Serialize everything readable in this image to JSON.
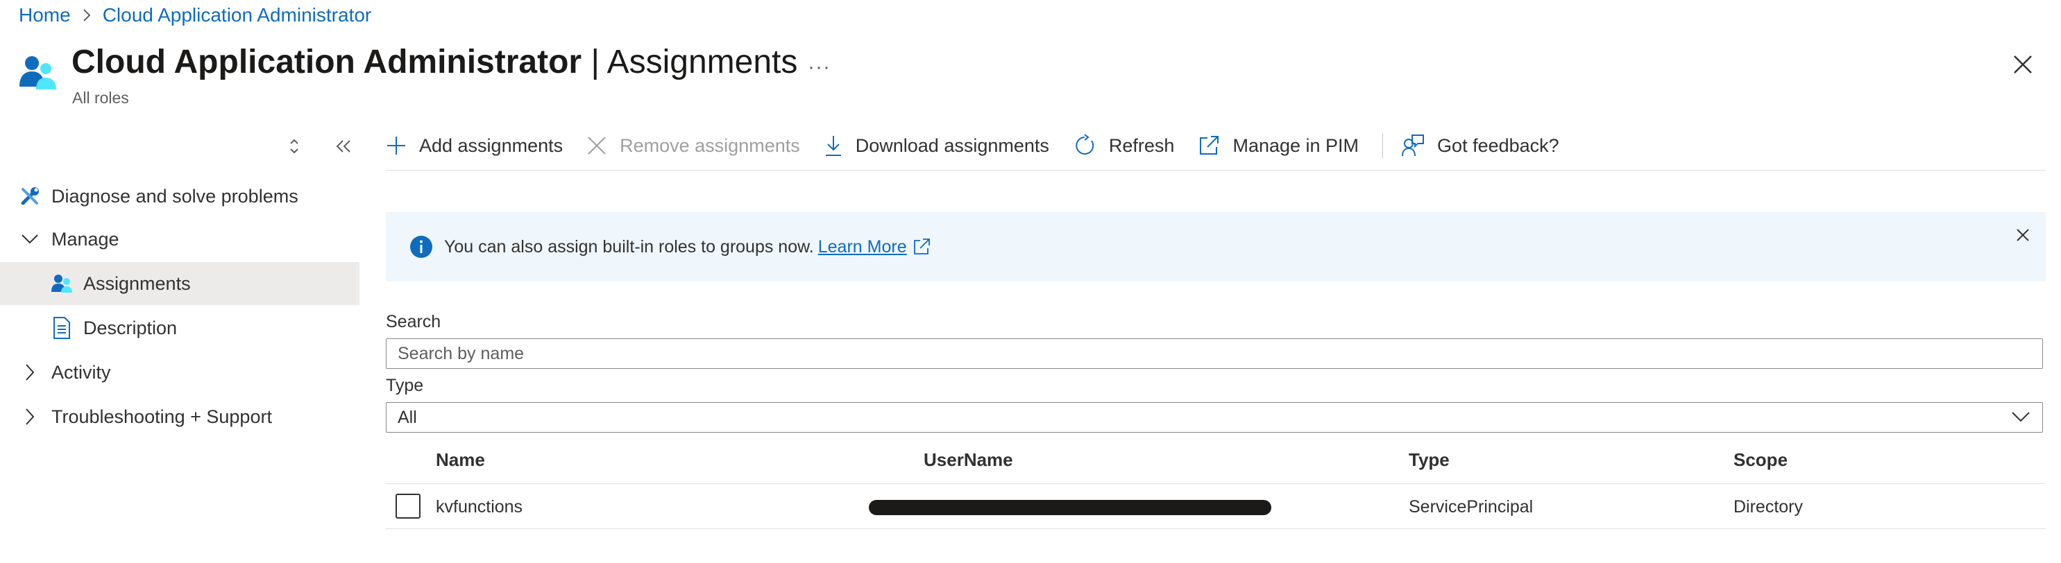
{
  "breadcrumb": {
    "home": "Home",
    "current": "Cloud Application Administrator"
  },
  "header": {
    "title_main": "Cloud Application Administrator",
    "title_separator": "|",
    "title_section": "Assignments",
    "subtitle": "All roles",
    "more_label": "···"
  },
  "nav": {
    "items": [
      {
        "label": "Diagnose and solve problems",
        "icon": "wrench-icon"
      },
      {
        "label": "Manage",
        "icon": "chevron-down-icon"
      },
      {
        "label": "Assignments",
        "icon": "users-icon",
        "selected": true
      },
      {
        "label": "Description",
        "icon": "document-icon"
      },
      {
        "label": "Activity",
        "icon": "chevron-right-icon"
      },
      {
        "label": "Troubleshooting + Support",
        "icon": "chevron-right-icon"
      }
    ]
  },
  "toolbar": {
    "add": "Add assignments",
    "remove": "Remove assignments",
    "download": "Download assignments",
    "refresh": "Refresh",
    "manage_pim": "Manage in PIM",
    "feedback": "Got feedback?"
  },
  "banner": {
    "text": "You can also assign built-in roles to groups now.",
    "link": "Learn More"
  },
  "filters": {
    "search_label": "Search",
    "search_placeholder": "Search by name",
    "search_value": "",
    "type_label": "Type",
    "type_value": "All"
  },
  "table": {
    "columns": [
      "Name",
      "UserName",
      "Type",
      "Scope"
    ],
    "rows": [
      {
        "name": "kvfunctions",
        "username": "",
        "type": "ServicePrincipal",
        "scope": "Directory"
      }
    ]
  },
  "colors": {
    "accent": "#0f6cbd",
    "selected_nav_bg": "#edebe9",
    "banner_bg": "#eff6fc",
    "info_icon": "#0f6cbd"
  }
}
